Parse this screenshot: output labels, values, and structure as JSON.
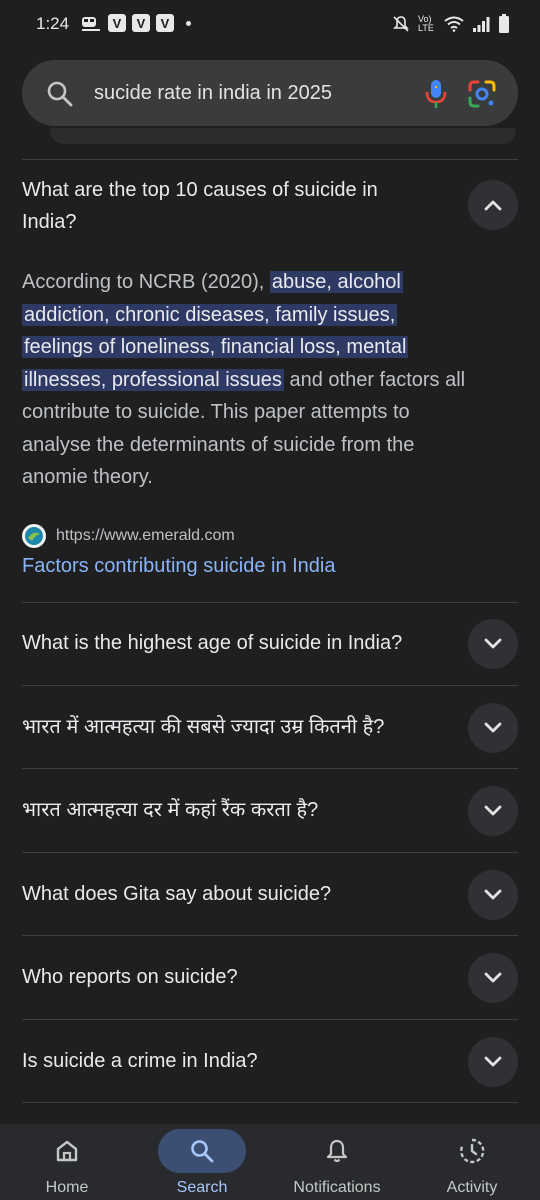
{
  "status_bar": {
    "time": "1:24",
    "notif_badges": [
      "V",
      "V",
      "V"
    ],
    "network_label": "Vo) LTE"
  },
  "search": {
    "query": "sucide rate in india in 2025"
  },
  "faq": {
    "expanded": {
      "question_line1": "What are the top 10 causes of suicide in",
      "question_line2": "India?",
      "answer_intro": "According to NCRB (2020), ",
      "answer_highlight_1": "abuse, alcohol",
      "answer_highlight_2": "addiction, chronic diseases, family issues,",
      "answer_highlight_3": "feelings of loneliness, financial loss, mental",
      "answer_highlight_4": "illnesses, professional issues",
      "answer_tail_1": " and other factors all",
      "answer_tail_2": "contribute to suicide. This paper attempts to",
      "answer_tail_3": "analyse the determinants of suicide from the",
      "answer_tail_4": "anomie theory.",
      "source_url": "https://www.emerald.com",
      "source_title": "Factors contributing suicide in India"
    },
    "collapsed": [
      "What is the highest age of suicide in India?",
      "भारत में आत्महत्या की सबसे ज्यादा उम्र कितनी है?",
      "भारत आत्महत्या दर में कहां रैंक करता है?",
      "What does Gita say about suicide?",
      "Who reports on suicide?",
      "Is suicide a crime in India?"
    ]
  },
  "bottom_nav": {
    "home": "Home",
    "search": "Search",
    "notifications": "Notifications",
    "activity": "Activity",
    "active": "search"
  },
  "colors": {
    "background": "#1f1f1f",
    "link": "#8ab4f8",
    "highlight": "#2f3a64",
    "nav_active": "#3d4e73"
  }
}
